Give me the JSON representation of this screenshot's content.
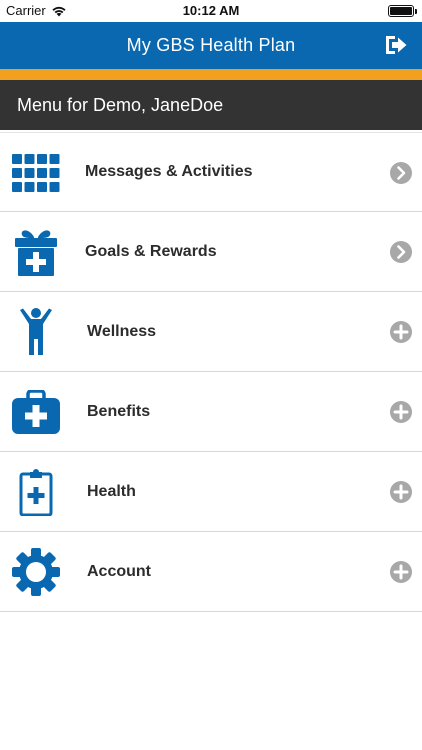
{
  "status_bar": {
    "carrier": "Carrier",
    "time": "10:12 AM"
  },
  "header": {
    "title": "My GBS Health Plan",
    "logout_icon": "logout-icon"
  },
  "colors": {
    "header_blue": "#0a68b0",
    "accent_orange": "#f2a01f",
    "banner_dark": "#333333",
    "icon_blue": "#0a68b0",
    "action_gray": "#a8a8a8"
  },
  "banner": {
    "text": "Menu for Demo, JaneDoe"
  },
  "menu": {
    "items": [
      {
        "label": "Messages & Activities",
        "icon": "grid-icon",
        "action": "chevron-right-icon"
      },
      {
        "label": "Goals & Rewards",
        "icon": "gift-icon",
        "action": "chevron-right-icon"
      },
      {
        "label": "Wellness",
        "icon": "person-icon",
        "action": "plus-icon"
      },
      {
        "label": "Benefits",
        "icon": "medical-bag-icon",
        "action": "plus-icon"
      },
      {
        "label": "Health",
        "icon": "clipboard-icon",
        "action": "plus-icon"
      },
      {
        "label": "Account",
        "icon": "gear-icon",
        "action": "plus-icon"
      }
    ]
  }
}
